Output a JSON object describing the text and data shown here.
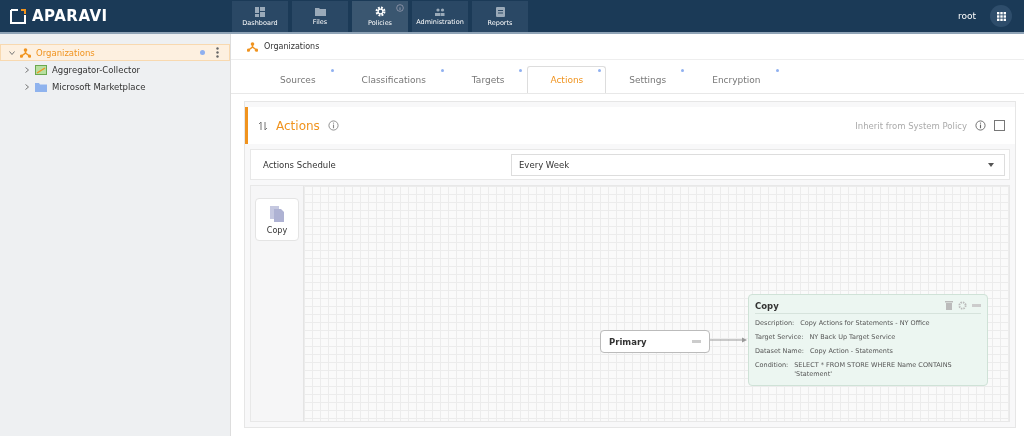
{
  "header": {
    "logo": "APARAVI",
    "nav": [
      {
        "label": "Dashboard",
        "kind": "dashboard",
        "selected": false,
        "info": false
      },
      {
        "label": "Files",
        "kind": "folder",
        "selected": false,
        "info": false
      },
      {
        "label": "Policies",
        "kind": "gear",
        "selected": true,
        "info": true
      },
      {
        "label": "Administration",
        "kind": "people",
        "selected": false,
        "info": false
      },
      {
        "label": "Reports",
        "kind": "clipboard",
        "selected": false,
        "info": false
      }
    ],
    "user": "root"
  },
  "sidebar": {
    "tree": [
      {
        "label": "Organizations",
        "kind": "org",
        "selected": true,
        "expanded": true,
        "children": [
          {
            "label": "Aggregator-Collector",
            "kind": "collector",
            "selected": false,
            "expanded": false
          },
          {
            "label": "Microsoft Marketplace",
            "kind": "folder",
            "selected": false,
            "expanded": false
          }
        ]
      }
    ]
  },
  "breadcrumb": "Organizations",
  "tabs": [
    {
      "label": "Sources",
      "selected": false
    },
    {
      "label": "Classifications",
      "selected": false
    },
    {
      "label": "Targets",
      "selected": false
    },
    {
      "label": "Actions",
      "selected": true
    },
    {
      "label": "Settings",
      "selected": false
    },
    {
      "label": "Encryption",
      "selected": false
    }
  ],
  "section": {
    "title": "Actions",
    "inherit_label": "Inherit from System Policy",
    "inherit_checked": false
  },
  "schedule": {
    "label": "Actions Schedule",
    "value": "Every Week"
  },
  "palette": [
    "Copy"
  ],
  "flow": {
    "source": {
      "title": "Primary"
    },
    "action": {
      "title": "Copy",
      "fields": [
        {
          "label": "Description:",
          "value": "Copy Actions for Statements - NY Office"
        },
        {
          "label": "Target Service:",
          "value": "NY Back Up Target Service"
        },
        {
          "label": "Dataset Name:",
          "value": "Copy Action - Statements"
        },
        {
          "label": "Condition:",
          "value": "SELECT * FROM STORE WHERE Name CONTAINS 'Statement'"
        }
      ]
    }
  }
}
